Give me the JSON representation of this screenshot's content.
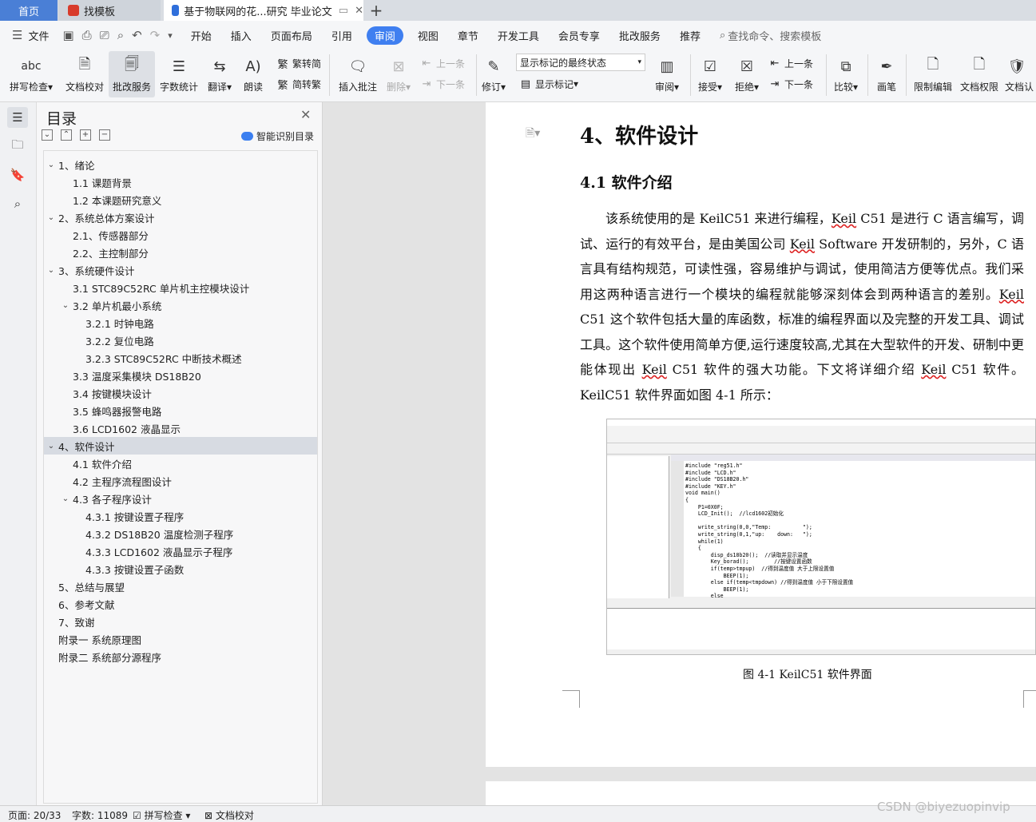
{
  "tabs": {
    "home": "首页",
    "template": "找模板",
    "document": "基于物联网的花...研究 毕业论文"
  },
  "menu": {
    "file": "文件",
    "items": [
      "开始",
      "插入",
      "页面布局",
      "引用",
      "审阅",
      "视图",
      "章节",
      "开发工具",
      "会员专享",
      "批改服务",
      "推荐"
    ],
    "active_index": 4,
    "search_placeholder": "查找命令、搜索模板"
  },
  "ribbon": {
    "spell_check": "拼写检查",
    "doc_proof": "文档校对",
    "revise_service": "批改服务",
    "word_count": "字数统计",
    "translate": "翻译",
    "read_aloud": "朗读",
    "trad_simp": "繁转简",
    "simp_trad": "简转繁",
    "insert_comment": "插入批注",
    "delete": "删除",
    "prev_comment": "上一条",
    "next_comment": "下一条",
    "track_changes": "修订",
    "markup_select": "显示标记的最终状态",
    "show_markup": "显示标记",
    "review": "审阅",
    "accept": "接受",
    "reject": "拒绝",
    "prev_change": "上一条",
    "next_change": "下一条",
    "compare": "比较",
    "pen": "画笔",
    "restrict_edit": "限制编辑",
    "doc_permission": "文档权限",
    "doc_cert": "文档认"
  },
  "toc": {
    "title": "目录",
    "smart": "智能识别目录",
    "items": [
      {
        "text": "1、绪论",
        "level": 1,
        "caret": "open"
      },
      {
        "text": "1.1 课题背景",
        "level": 2,
        "caret": ""
      },
      {
        "text": "1.2  本课题研究意义",
        "level": 2,
        "caret": ""
      },
      {
        "text": "2、系统总体方案设计",
        "level": 1,
        "caret": "open"
      },
      {
        "text": "2.1、传感器部分",
        "level": 2,
        "caret": ""
      },
      {
        "text": "2.2、主控制部分",
        "level": 2,
        "caret": ""
      },
      {
        "text": "3、系统硬件设计",
        "level": 1,
        "caret": "open"
      },
      {
        "text": "3.1 STC89C52RC 单片机主控模块设计",
        "level": 2,
        "caret": ""
      },
      {
        "text": "3.2 单片机最小系统",
        "level": 2,
        "caret": "open"
      },
      {
        "text": "3.2.1 时钟电路",
        "level": 3,
        "caret": ""
      },
      {
        "text": "3.2.2 复位电路",
        "level": 3,
        "caret": ""
      },
      {
        "text": "3.2.3 STC89C52RC 中断技术概述",
        "level": 3,
        "caret": ""
      },
      {
        "text": "3.3  温度采集模块 DS18B20",
        "level": 2,
        "caret": ""
      },
      {
        "text": "3.4 按键模块设计",
        "level": 2,
        "caret": ""
      },
      {
        "text": "3.5 蜂鸣器报警电路",
        "level": 2,
        "caret": ""
      },
      {
        "text": "3.6 LCD1602 液晶显示",
        "level": 2,
        "caret": ""
      },
      {
        "text": "4、软件设计",
        "level": 1,
        "caret": "open",
        "selected": true
      },
      {
        "text": "4.1 软件介绍",
        "level": 2,
        "caret": ""
      },
      {
        "text": "4.2  主程序流程图设计",
        "level": 2,
        "caret": ""
      },
      {
        "text": "4.3 各子程序设计",
        "level": 2,
        "caret": "open"
      },
      {
        "text": "4.3.1 按键设置子程序",
        "level": 3,
        "caret": ""
      },
      {
        "text": "4.3.2 DS18B20 温度检测子程序",
        "level": 3,
        "caret": ""
      },
      {
        "text": "4.3.3 LCD1602 液晶显示子程序",
        "level": 3,
        "caret": ""
      },
      {
        "text": "4.3.3  按键设置子函数",
        "level": 3,
        "caret": ""
      },
      {
        "text": "5、总结与展望",
        "level": 1,
        "caret": ""
      },
      {
        "text": "6、参考文献",
        "level": 1,
        "caret": ""
      },
      {
        "text": "7、致谢",
        "level": 1,
        "caret": ""
      },
      {
        "text": "附录一  系统原理图",
        "level": 1,
        "caret": ""
      },
      {
        "text": "附录二  系统部分源程序",
        "level": 1,
        "caret": ""
      }
    ]
  },
  "document": {
    "heading1": "4、软件设计",
    "heading2": "4.1 软件介绍",
    "p_a": "该系统使用的是 KeilC51 来进行编程，",
    "p_keil1": "Keil",
    "p_b": " C51 是进行 C 语言编写，调试、运行的有效平台，是由美国公司 ",
    "p_keil2": "Keil",
    "p_c": " Software 开发研制的，另外，C 语言具有结构规范，可读性强，容易维护与调试，使用简洁方便等优点。我们采用这两种语言进行一个模块的编程就能够深刻体会到两种语言的差别。",
    "p_keil3": "Keil",
    "p_d": " C51 这个软件包括大量的库函数，标准的编程界面以及完整的开发工具、调试工具。这个软件使用简单方便,运行速度较高,尤其在大型软件的开发、研制中更能体现出 ",
    "p_keil4": "Keil",
    "p_e": " C51 软件的强大功能。下文将详细介绍 ",
    "p_keil5": "Keil",
    "p_f": " C51 软件。KeilC51 软件界面如图 4-1 所示：",
    "figure_caption": "图 4-1 KeilC51 软件界面",
    "code": "#include \"reg51.h\"\n#include \"LCD.h\"\n#include \"DS18B20.h\"\n#include \"KEY.h\"\nvoid main()\n{\n    P1=0X0F;\n    LCD_Init();  //lcd1602初始化\n\n    write_string(0,0,\"Temp:          \");\n    write_string(0,1,\"up:    down:   \");\n    while(1)\n    {\n        disp_ds18b20();  //读取并显示温度\n        Key_borad();        //按键设置函数\n        if(temp>tmpup)  //得到温度值 大于上限设置值\n            BEEP(1);\n        else if(temp<tmpdown) //得到温度值 小于下限设置值\n            BEEP(1);\n        else"
  },
  "status": {
    "page": "页面: 20/33",
    "words": "字数: 11089",
    "spell": "拼写检查",
    "proof": "文档校对"
  },
  "watermark": "CSDN @biyezuopinvip",
  "colors": {
    "accent": "#3f7ff0",
    "tab_home": "#4a7fd6"
  }
}
